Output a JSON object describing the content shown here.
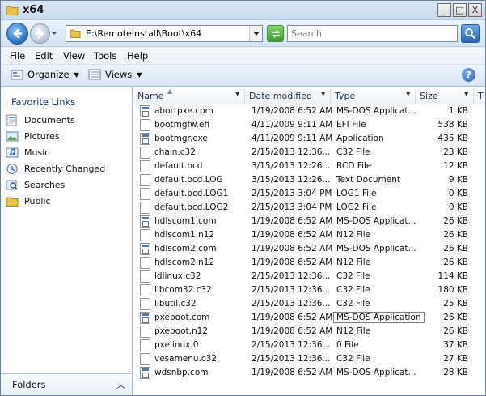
{
  "window": {
    "title": "x64",
    "controls": [
      "_",
      "□",
      "X"
    ]
  },
  "nav": {
    "address": "E:\\RemoteInstall\\Boot\\x64",
    "search_placeholder": "Search"
  },
  "menu": [
    "File",
    "Edit",
    "View",
    "Tools",
    "Help"
  ],
  "toolbar": {
    "organize": "Organize",
    "views": "Views"
  },
  "favorites": {
    "title": "Favorite Links",
    "items": [
      {
        "label": "Documents",
        "icon": "documents-icon"
      },
      {
        "label": "Pictures",
        "icon": "pictures-icon"
      },
      {
        "label": "Music",
        "icon": "music-icon"
      },
      {
        "label": "Recently Changed",
        "icon": "recently-changed-icon"
      },
      {
        "label": "Searches",
        "icon": "searches-icon"
      },
      {
        "label": "Public",
        "icon": "public-folder-icon"
      }
    ]
  },
  "folders_label": "Folders",
  "columns": {
    "name": "Name",
    "date": "Date modified",
    "type": "Type",
    "size": "Size",
    "tags": "T"
  },
  "files": [
    {
      "name": "abortpxe.com",
      "date": "1/19/2008 6:52 AM",
      "type": "MS-DOS Applicat...",
      "size": "1 KB",
      "icon": "app"
    },
    {
      "name": "bootmgfw.efi",
      "date": "4/11/2009 9:11 AM",
      "type": "EFI File",
      "size": "538 KB",
      "icon": "file"
    },
    {
      "name": "bootmgr.exe",
      "date": "4/11/2009 9:11 AM",
      "type": "Application",
      "size": "435 KB",
      "icon": "app"
    },
    {
      "name": "chain.c32",
      "date": "2/15/2013 12:36...",
      "type": "C32 File",
      "size": "23 KB",
      "icon": "file"
    },
    {
      "name": "default.bcd",
      "date": "3/15/2013 12:26...",
      "type": "BCD File",
      "size": "12 KB",
      "icon": "file"
    },
    {
      "name": "default.bcd.LOG",
      "date": "3/15/2013 12:26...",
      "type": "Text Document",
      "size": "9 KB",
      "icon": "file"
    },
    {
      "name": "default.bcd.LOG1",
      "date": "2/15/2013 3:04 PM",
      "type": "LOG1 File",
      "size": "0 KB",
      "icon": "file"
    },
    {
      "name": "default.bcd.LOG2",
      "date": "2/15/2013 3:04 PM",
      "type": "LOG2 File",
      "size": "0 KB",
      "icon": "file"
    },
    {
      "name": "hdlscom1.com",
      "date": "1/19/2008 6:52 AM",
      "type": "MS-DOS Applicat...",
      "size": "26 KB",
      "icon": "app"
    },
    {
      "name": "hdlscom1.n12",
      "date": "1/19/2008 6:52 AM",
      "type": "N12 File",
      "size": "26 KB",
      "icon": "file"
    },
    {
      "name": "hdlscom2.com",
      "date": "1/19/2008 6:52 AM",
      "type": "MS-DOS Applicat...",
      "size": "26 KB",
      "icon": "app"
    },
    {
      "name": "hdlscom2.n12",
      "date": "1/19/2008 6:52 AM",
      "type": "N12 File",
      "size": "26 KB",
      "icon": "file"
    },
    {
      "name": "ldlinux.c32",
      "date": "2/15/2013 12:36...",
      "type": "C32 File",
      "size": "114 KB",
      "icon": "file"
    },
    {
      "name": "libcom32.c32",
      "date": "2/15/2013 12:36...",
      "type": "C32 File",
      "size": "180 KB",
      "icon": "file"
    },
    {
      "name": "libutil.c32",
      "date": "2/15/2013 12:36...",
      "type": "C32 File",
      "size": "25 KB",
      "icon": "file"
    },
    {
      "name": "pxeboot.com",
      "date": "1/19/2008 6:52 AM",
      "type": "MS-DOS Application",
      "size": "26 KB",
      "icon": "app",
      "tooltip": true
    },
    {
      "name": "pxeboot.n12",
      "date": "1/19/2008 6:52 AM",
      "type": "N12 File",
      "size": "26 KB",
      "icon": "file"
    },
    {
      "name": "pxelinux.0",
      "date": "2/15/2013 12:36...",
      "type": "0 File",
      "size": "37 KB",
      "icon": "file"
    },
    {
      "name": "vesamenu.c32",
      "date": "2/15/2013 12:36...",
      "type": "C32 File",
      "size": "27 KB",
      "icon": "file"
    },
    {
      "name": "wdsnbp.com",
      "date": "1/19/2008 6:52 AM",
      "type": "MS-DOS Applicat...",
      "size": "28 KB",
      "icon": "app"
    }
  ]
}
